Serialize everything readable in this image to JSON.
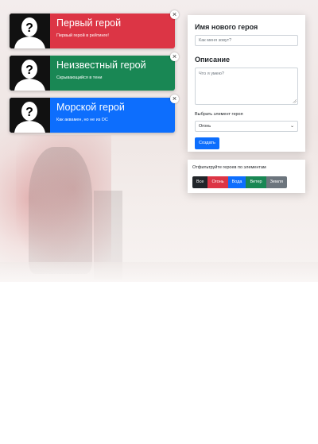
{
  "heroes": [
    {
      "title": "Первый герой",
      "description": "Первый герой в рейтинге!",
      "color": "#dc3545"
    },
    {
      "title": "Неизвестный герой",
      "description": "Скрывающийся в тени",
      "color": "#198754"
    },
    {
      "title": "Морской герой",
      "description": "Как аквамен, но не из DC",
      "color": "#0d6efd"
    }
  ],
  "close_symbol": "×",
  "form": {
    "name_label": "Имя нового героя",
    "name_placeholder": "Как меня зовут?",
    "description_label": "Описание",
    "description_placeholder": "Что я умею?",
    "element_label": "Выбрать элемент героя",
    "element_selected": "Огонь",
    "create_label": "Создать"
  },
  "filter": {
    "title": "Отфильтруйте героев по элементам",
    "buttons": [
      {
        "label": "Все",
        "color": "#212529"
      },
      {
        "label": "Огонь",
        "color": "#dc3545"
      },
      {
        "label": "Вода",
        "color": "#0d6efd"
      },
      {
        "label": "Ветер",
        "color": "#198754"
      },
      {
        "label": "Земля",
        "color": "#6c757d"
      }
    ]
  }
}
